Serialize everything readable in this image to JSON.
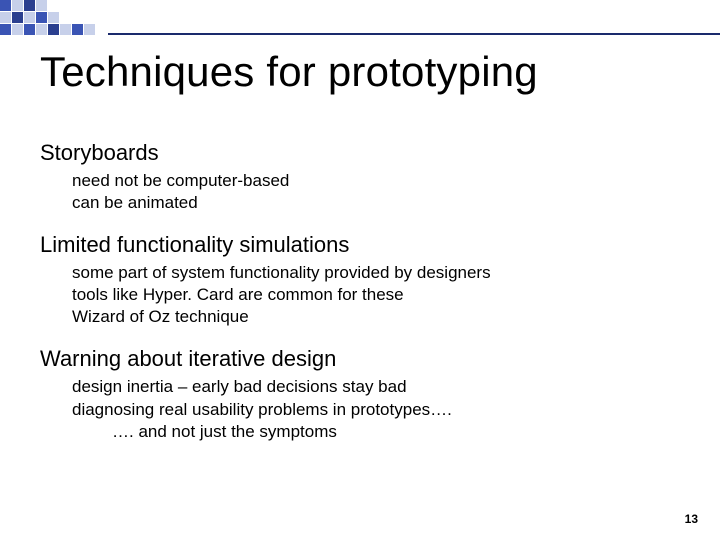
{
  "deco": {
    "colors": [
      "#3a54b4",
      "#c7d0ea",
      "#2b3f8f",
      "#c7d0ea",
      "#ffffff",
      "#ffffff",
      "#ffffff",
      "#ffffff",
      "#ffffff",
      "#c7d0ea",
      "#2b3f8f",
      "#c7d0ea",
      "#3a54b4",
      "#c7d0ea",
      "#ffffff",
      "#ffffff",
      "#ffffff",
      "#ffffff",
      "#3a54b4",
      "#c7d0ea",
      "#3a54b4",
      "#c7d0ea",
      "#2b3f8f",
      "#c7d0ea",
      "#3a54b4",
      "#c7d0ea",
      "#ffffff"
    ]
  },
  "title": "Techniques for prototyping",
  "sections": [
    {
      "head": "Storyboards",
      "subs": [
        "need not be computer-based",
        "can be animated"
      ]
    },
    {
      "head": "Limited functionality simulations",
      "subs": [
        "some part of system functionality provided by designers",
        "tools like Hyper. Card are common for these",
        "Wizard of Oz technique"
      ]
    },
    {
      "head": "Warning about iterative design",
      "subs": [
        "design inertia – early bad decisions stay bad",
        "diagnosing real usability problems in prototypes….",
        "…. and not just the symptoms"
      ]
    }
  ],
  "page_number": "13"
}
